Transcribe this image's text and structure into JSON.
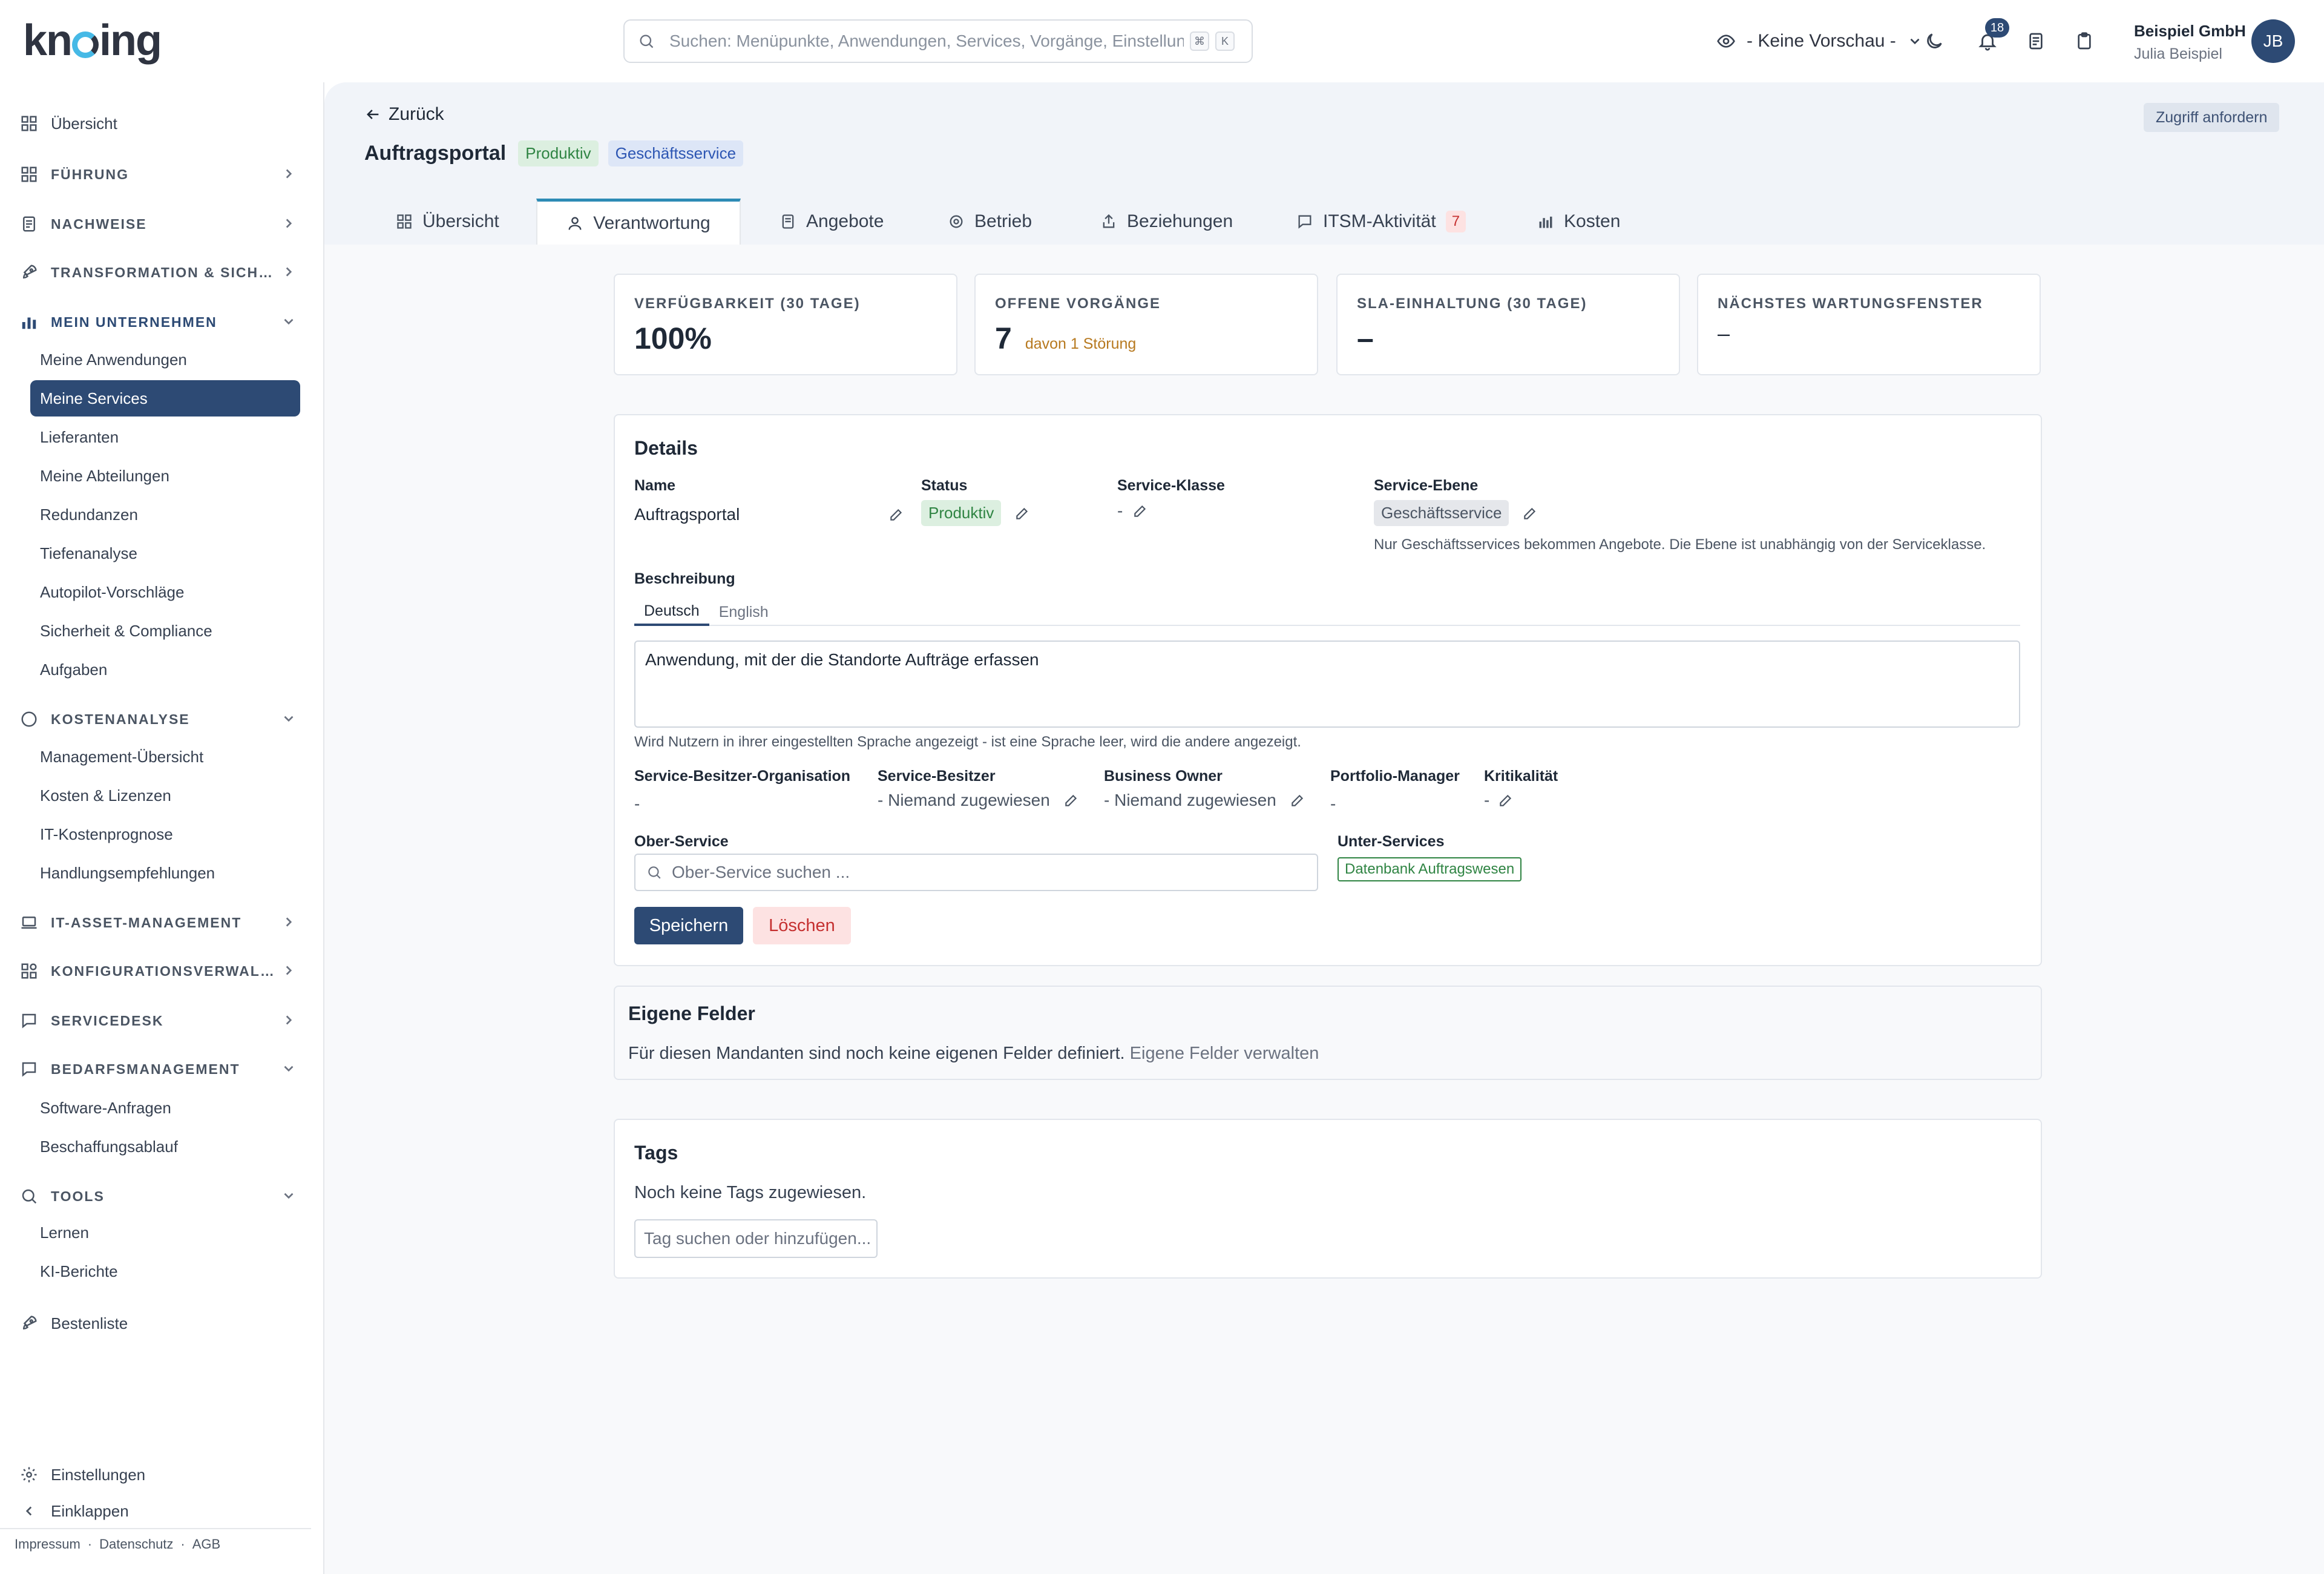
{
  "brand": {
    "logo_text_pre": "kn",
    "logo_text_post": "ing"
  },
  "search": {
    "placeholder": "Suchen: Menüpunkte, Anwendungen, Services, Vorgänge, Einstellungen",
    "kbd_meta": "⌘",
    "kbd_key": "K"
  },
  "topbar": {
    "preview_label": "- Keine Vorschau -",
    "notification_count": "18",
    "org": "Beispiel GmbH",
    "user_name": "Julia Beispiel",
    "avatar_initials": "JB"
  },
  "sidebar": {
    "overview": "Übersicht",
    "sections": {
      "fuehrung": "Führung",
      "nachweise": "Nachweise",
      "transformation": "Transformation & Sich…",
      "unternehmen": "Mein Unternehmen",
      "kosten": "Kostenanalyse",
      "asset": "IT-Asset-Management",
      "konfig": "Konfigurationsverwal…",
      "servicedesk": "Servicedesk",
      "bedarf": "Bedarfsmanagement",
      "tools": "Tools"
    },
    "unternehmen_items": [
      "Meine Anwendungen",
      "Meine Services",
      "Lieferanten",
      "Meine Abteilungen",
      "Redundanzen",
      "Tiefenanalyse",
      "Autopilot-Vorschläge",
      "Sicherheit & Compliance",
      "Aufgaben"
    ],
    "kosten_items": [
      "Management-Übersicht",
      "Kosten & Lizenzen",
      "IT-Kostenprognose",
      "Handlungsempfehlungen"
    ],
    "bedarf_items": [
      "Software-Anfragen",
      "Beschaffungsablauf"
    ],
    "tools_items": [
      "Lernen",
      "KI-Berichte"
    ],
    "leaderboard": "Bestenliste",
    "settings": "Einstellungen",
    "collapse": "Einklappen",
    "legal": [
      "Impressum",
      "·",
      "Datenschutz",
      "·",
      "AGB"
    ]
  },
  "header": {
    "back": "Zurück",
    "title": "Auftragsportal",
    "status_badge": "Produktiv",
    "level_badge": "Geschäftsservice",
    "access_button": "Zugriff anfordern"
  },
  "tabs": [
    "Übersicht",
    "Verantwortung",
    "Angebote",
    "Betrieb",
    "Beziehungen",
    "ITSM-Aktivität",
    "Kosten"
  ],
  "tab_itsm_count": "7",
  "kpis": [
    {
      "label": "Verfügbarkeit (30 Tage)",
      "value": "100%"
    },
    {
      "label": "Offene Vorgänge",
      "value": "7",
      "sub": "davon 1 Störung"
    },
    {
      "label": "SLA-Einhaltung (30 Tage)",
      "value": "–"
    },
    {
      "label": "Nächstes Wartungsfenster",
      "value": "–"
    }
  ],
  "details": {
    "title": "Details",
    "name_label": "Name",
    "name_value": "Auftragsportal",
    "status_label": "Status",
    "status_value": "Produktiv",
    "class_label": "Service-Klasse",
    "class_value": "-",
    "level_label": "Service-Ebene",
    "level_value": "Geschäftsservice",
    "level_hint": "Nur Geschäftsservices bekommen Angebote. Die Ebene ist unabhängig von der Serviceklasse.",
    "description_label": "Beschreibung",
    "lang_de": "Deutsch",
    "lang_en": "English",
    "description_value": "Anwendung, mit der die Standorte Aufträge erfassen",
    "description_hint": "Wird Nutzern in ihrer eingestellten Sprache angezeigt - ist eine Sprache leer, wird die andere angezeigt.",
    "owner_org_label": "Service-Besitzer-Organisation",
    "owner_org_value": "-",
    "owner_label": "Service-Besitzer",
    "owner_value": "- Niemand zugewiesen",
    "business_owner_label": "Business Owner",
    "business_owner_value": "- Niemand zugewiesen",
    "portfolio_label": "Portfolio-Manager",
    "portfolio_value": "-",
    "criticality_label": "Kritikalität",
    "criticality_value": "-",
    "parent_label": "Ober-Service",
    "parent_placeholder": "Ober-Service suchen ...",
    "children_label": "Unter-Services",
    "children_value": "Datenbank Auftragswesen",
    "save": "Speichern",
    "delete": "Löschen"
  },
  "custom_fields": {
    "title": "Eigene Felder",
    "text": "Für diesen Mandanten sind noch keine eigenen Felder definiert.",
    "link": "Eigene Felder verwalten"
  },
  "tags": {
    "title": "Tags",
    "text": "Noch keine Tags zugewiesen.",
    "placeholder": "Tag suchen oder hinzufügen..."
  }
}
